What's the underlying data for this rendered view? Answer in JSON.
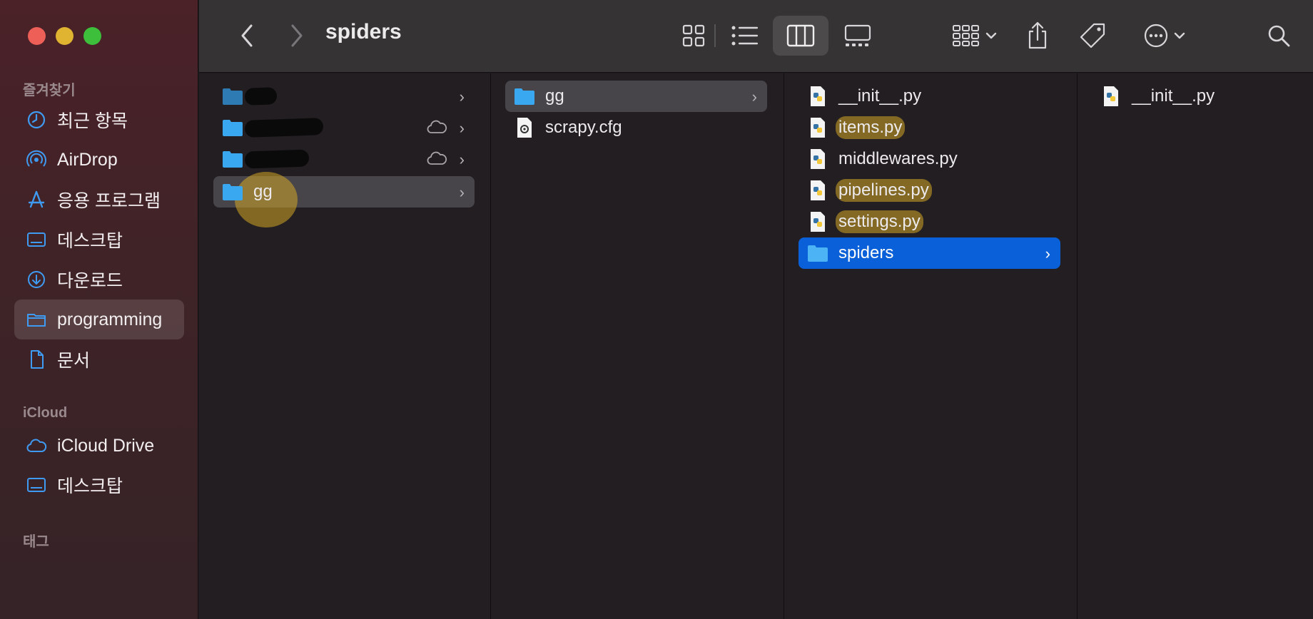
{
  "window": {
    "title": "spiders"
  },
  "sidebar": {
    "favorites_label": "즐겨찾기",
    "favorites": [
      {
        "label": "최근 항목",
        "icon": "clock-icon"
      },
      {
        "label": "AirDrop",
        "icon": "airdrop-icon"
      },
      {
        "label": "응용 프로그램",
        "icon": "applications-icon"
      },
      {
        "label": "데스크탑",
        "icon": "desktop-icon"
      },
      {
        "label": "다운로드",
        "icon": "download-icon"
      },
      {
        "label": "programming",
        "icon": "folder-icon",
        "selected": true
      },
      {
        "label": "문서",
        "icon": "document-icon"
      }
    ],
    "icloud_label": "iCloud",
    "icloud": [
      {
        "label": "iCloud Drive",
        "icon": "cloud-icon"
      },
      {
        "label": "데스크탑",
        "icon": "desktop-icon"
      }
    ],
    "tags_label": "태그"
  },
  "columns": {
    "col1": [
      {
        "label": "",
        "redacted": true
      },
      {
        "label": "",
        "redacted": true,
        "cloud": true
      },
      {
        "label": "",
        "redacted": true,
        "cloud": true
      },
      {
        "label": "gg",
        "selected": true
      }
    ],
    "col2": [
      {
        "label": "gg",
        "type": "folder",
        "selected": true
      },
      {
        "label": "scrapy.cfg",
        "type": "config"
      }
    ],
    "col3": [
      {
        "label": "__init__.py",
        "type": "python"
      },
      {
        "label": "items.py",
        "type": "python",
        "highlighted": true
      },
      {
        "label": "middlewares.py",
        "type": "python"
      },
      {
        "label": "pipelines.py",
        "type": "python",
        "highlighted": true
      },
      {
        "label": "settings.py",
        "type": "python",
        "highlighted": true
      },
      {
        "label": "spiders",
        "type": "folder",
        "selected": true
      }
    ],
    "col4": [
      {
        "label": "__init__.py",
        "type": "python"
      }
    ]
  },
  "colors": {
    "accent": "#0a60d8",
    "highlight": "#d4a828",
    "folder": "#3aa8f0"
  }
}
